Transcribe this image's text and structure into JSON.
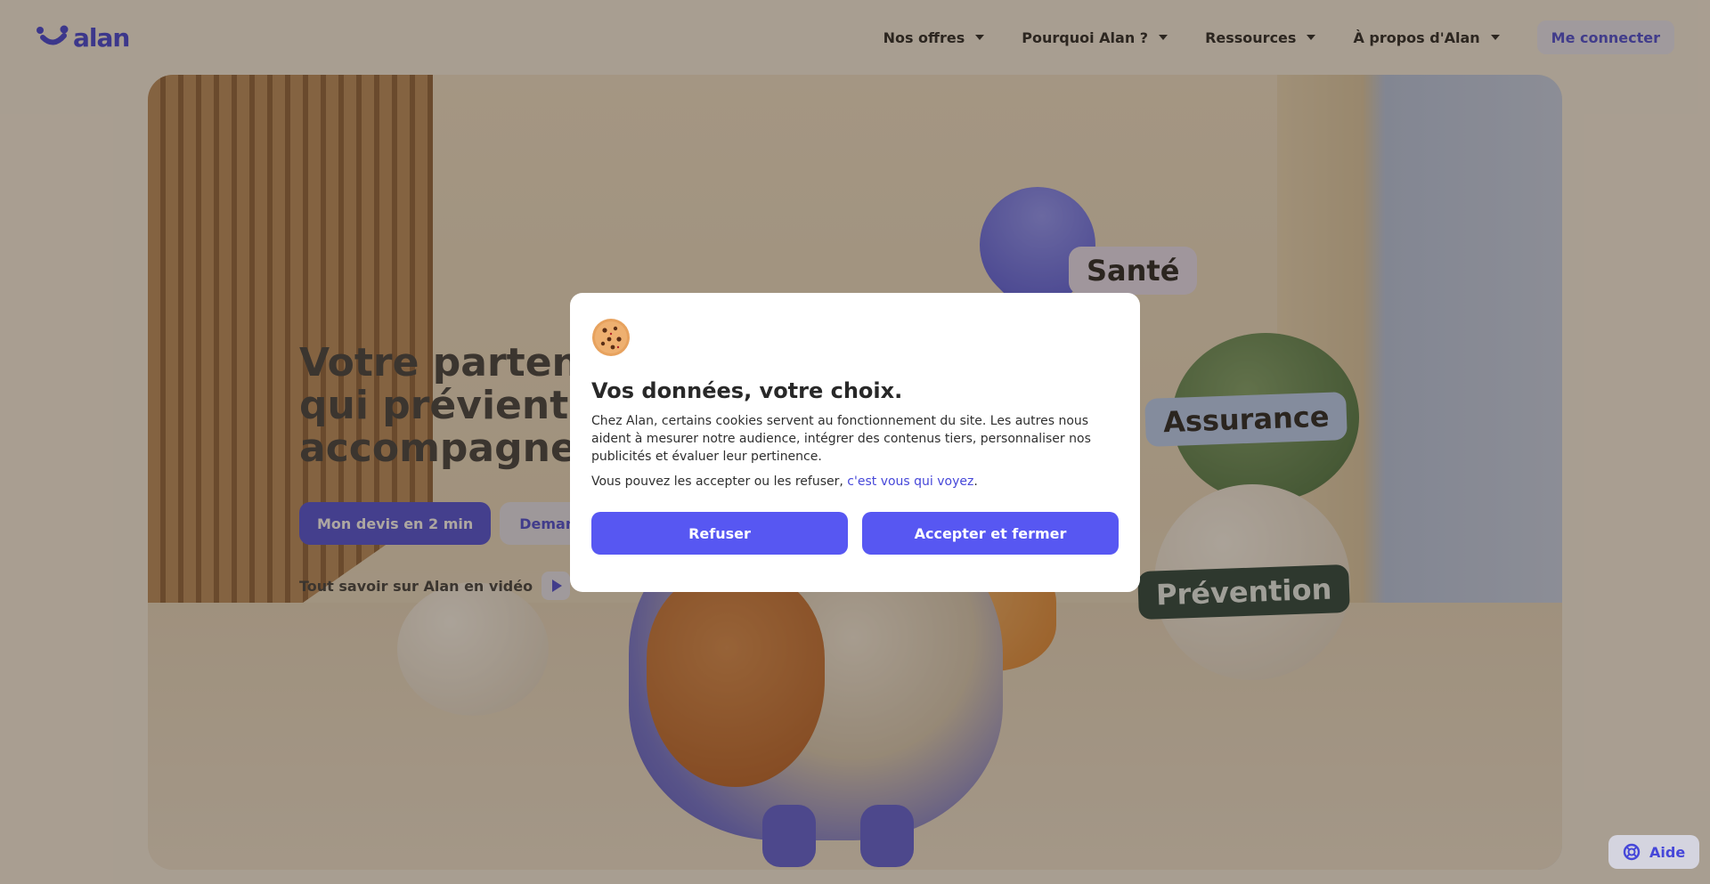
{
  "header": {
    "logo_text": "alan",
    "nav": [
      {
        "label": "Nos offres"
      },
      {
        "label": "Pourquoi Alan ?"
      },
      {
        "label": "Ressources"
      },
      {
        "label": "À propos d'Alan"
      }
    ],
    "login_label": "Me connecter"
  },
  "hero": {
    "title_lines": [
      "Votre partenaire",
      "qui prévient, assu",
      "accompagne au q"
    ],
    "cta_primary": "Mon devis en 2 min",
    "cta_secondary": "Demander u",
    "video_label": "Tout savoir sur Alan en vidéo",
    "tags": [
      "Santé",
      "Assurance",
      "Prévention"
    ]
  },
  "cookie_modal": {
    "title": "Vos données, votre choix.",
    "body": "Chez Alan, certains cookies servent au fonctionnement du site. Les autres nous aident à mesurer notre audience, intégrer des contenus tiers, personnaliser nos publicités et évaluer leur pertinence.",
    "body2_prefix": "Vous pouvez les accepter ou les refuser, ",
    "body2_link": "c'est vous qui voyez",
    "body2_suffix": ".",
    "refuse_label": "Refuser",
    "accept_label": "Accepter et fermer"
  },
  "help": {
    "label": "Aide"
  },
  "colors": {
    "brand": "#4647d9",
    "button": "#5757f2"
  }
}
